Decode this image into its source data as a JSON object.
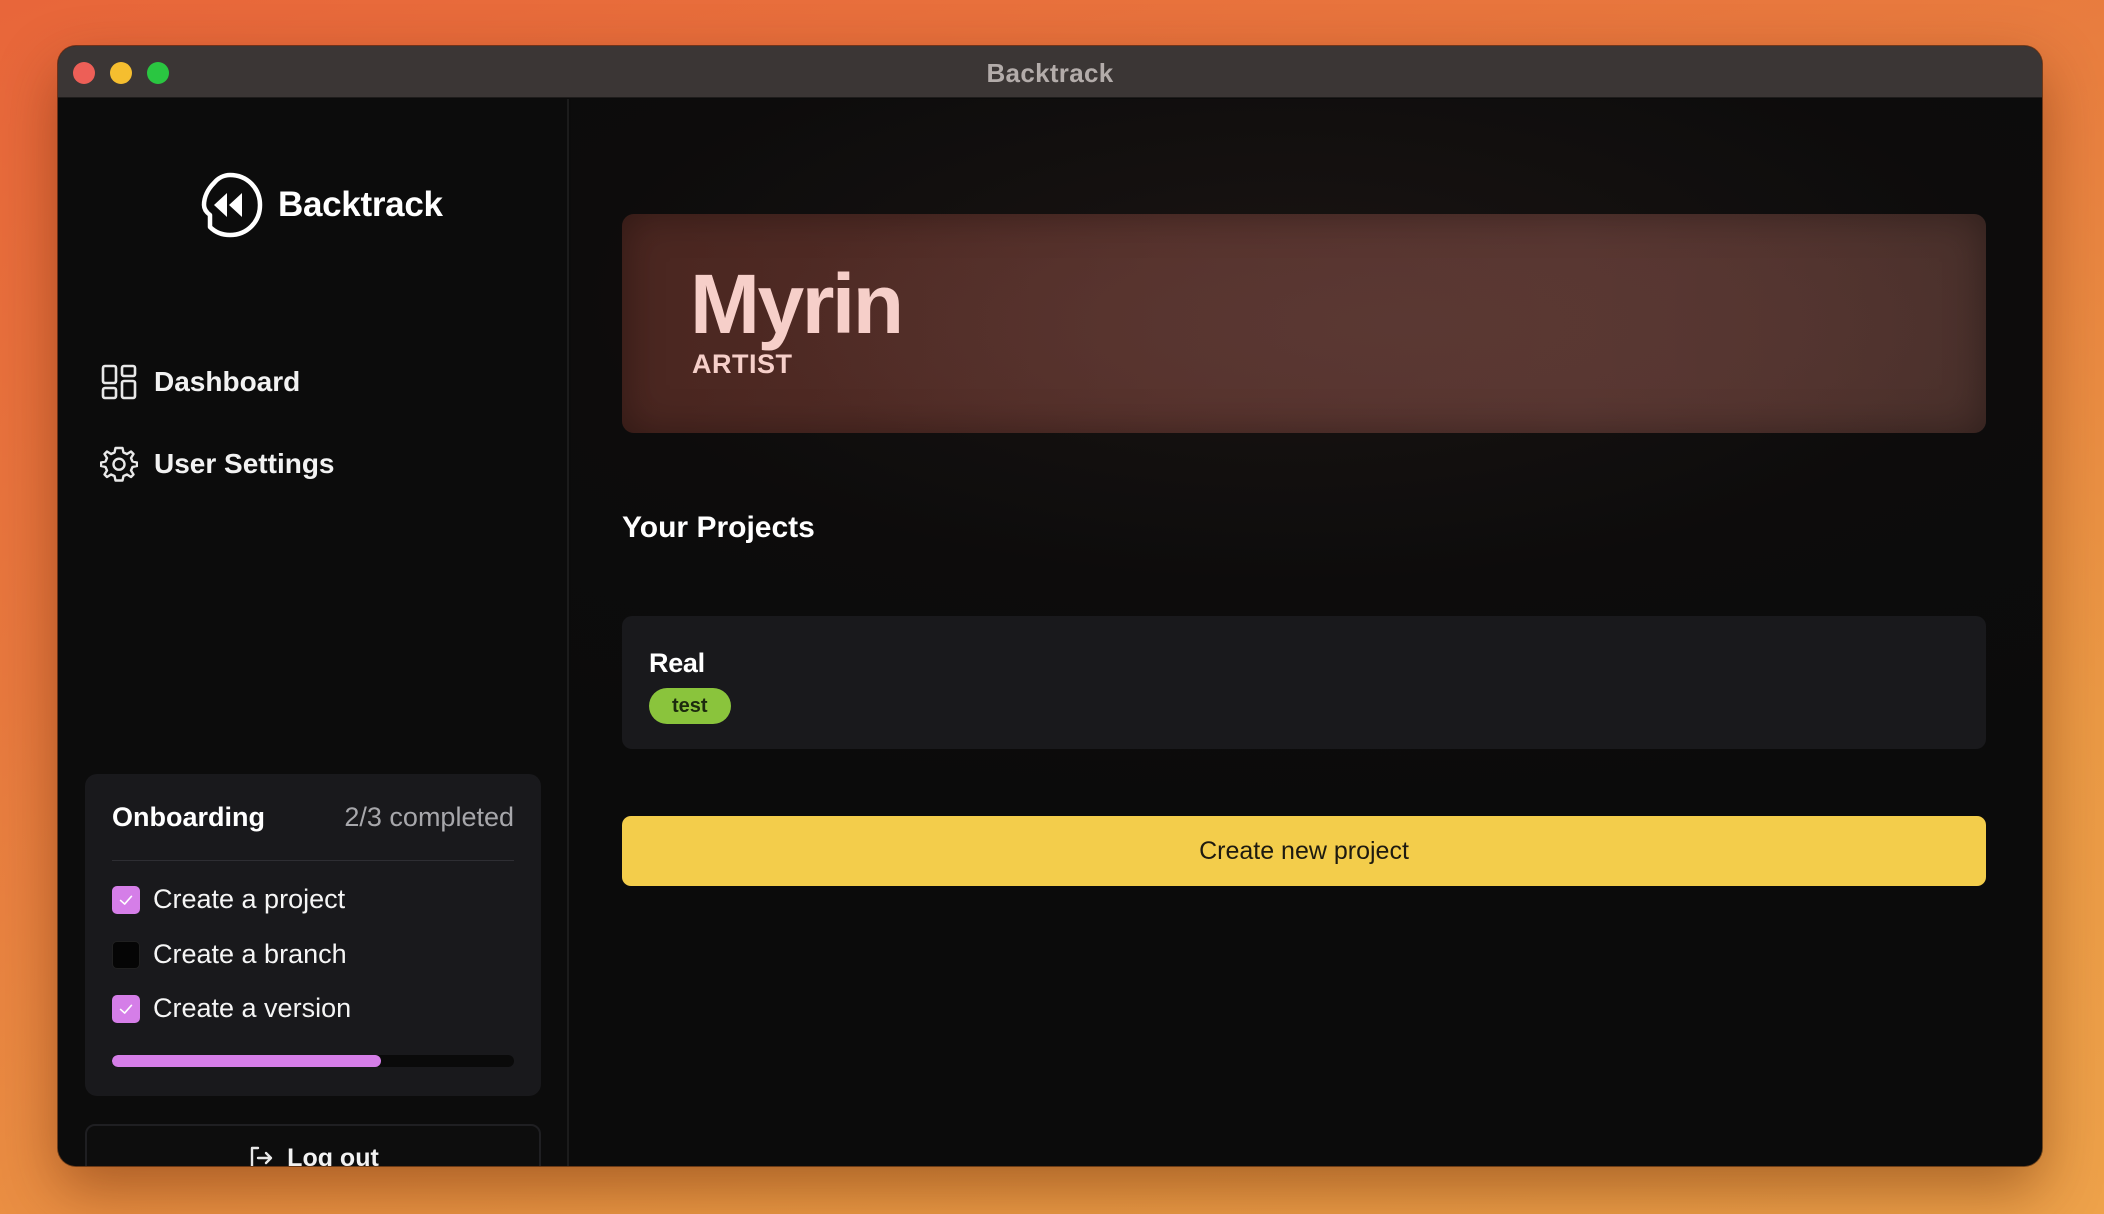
{
  "window": {
    "title": "Backtrack"
  },
  "sidebar": {
    "logo_text": "Backtrack",
    "nav": [
      {
        "label": "Dashboard",
        "icon": "dashboard-icon"
      },
      {
        "label": "User Settings",
        "icon": "gear-icon"
      }
    ],
    "onboarding": {
      "title": "Onboarding",
      "count": "2/3 completed",
      "progress": 0.67,
      "tasks": [
        {
          "label": "Create a project",
          "done": true
        },
        {
          "label": "Create a branch",
          "done": false
        },
        {
          "label": "Create a version",
          "done": true
        }
      ]
    },
    "logout_label": "Log out"
  },
  "main": {
    "profile": {
      "name": "Myrin",
      "role": "ARTIST"
    },
    "projects_title": "Your Projects",
    "projects": [
      {
        "name": "Real",
        "tag": "test"
      }
    ],
    "create_label": "Create new project"
  },
  "colors": {
    "accent_purple": "#d57ee8",
    "button_yellow": "#f3cd4b",
    "tag_green": "#8ac43c",
    "hero_text": "#f6cfc9"
  }
}
